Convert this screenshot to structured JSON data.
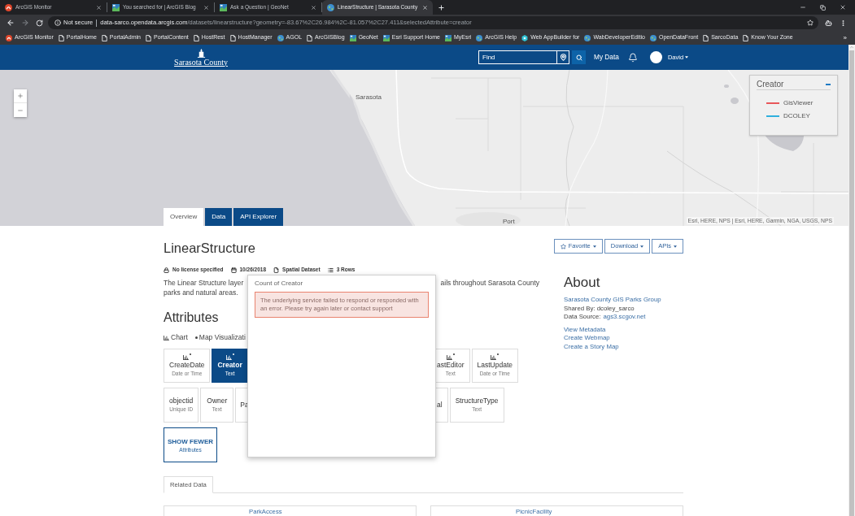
{
  "browser": {
    "tabs": [
      {
        "title": "ArcGIS Monitor",
        "kind": "monitor",
        "selected": false
      },
      {
        "title": "You searched for | ArcGIS Blog",
        "kind": "geonet",
        "selected": false
      },
      {
        "title": "Ask a Question | GeoNet",
        "kind": "geonet",
        "selected": false
      },
      {
        "title": "LinearStructure | Sarasota County",
        "kind": "globe",
        "selected": true
      }
    ],
    "forward_disabled": true,
    "address": {
      "security": "Not secure",
      "domain": "data-sarco.opendata.arcgis.com",
      "path": "/datasets/linearstructure?geometry=-83.67%2C26.984%2C-81.057%2C27.411&selectedAttribute=creator"
    },
    "bookmarks": [
      {
        "label": "ArcGIS Monitor",
        "kind": "monitor"
      },
      {
        "label": "PortalHome",
        "kind": "page"
      },
      {
        "label": "PortalAdmin",
        "kind": "page"
      },
      {
        "label": "PortalContent",
        "kind": "page"
      },
      {
        "label": "HostRest",
        "kind": "page"
      },
      {
        "label": "HostManager",
        "kind": "page"
      },
      {
        "label": "AGOL",
        "kind": "globe"
      },
      {
        "label": "ArcGISBlog",
        "kind": "page"
      },
      {
        "label": "GeoNet",
        "kind": "geonet"
      },
      {
        "label": "Esri Support Home",
        "kind": "geonet"
      },
      {
        "label": "MyEsri",
        "kind": "geonet"
      },
      {
        "label": "ArcGIS Help",
        "kind": "globe"
      },
      {
        "label": "Web AppBuilder for",
        "kind": "appbuilder"
      },
      {
        "label": "WabDeveloperEditio",
        "kind": "globe"
      },
      {
        "label": "OpenDataFront",
        "kind": "globe"
      },
      {
        "label": "SarcoData",
        "kind": "page"
      },
      {
        "label": "Know Your Zone",
        "kind": "page"
      }
    ],
    "bookmarks_more": "»"
  },
  "header": {
    "logo": "Sarasota County",
    "search": {
      "placeholder": "Find"
    },
    "nav_link": "My Data",
    "user": "David"
  },
  "map": {
    "labels": [
      "Sarasota",
      "Port"
    ],
    "legend": {
      "title": "Creator",
      "items": [
        {
          "label": "GisViewer",
          "color": "#e8575a"
        },
        {
          "label": "DCOLEY",
          "color": "#2fb0de"
        }
      ]
    },
    "attribution": "Esri, HERE, NPS | Esri, HERE, Garmin, NGA, USGS, NPS"
  },
  "tabs": [
    {
      "label": "Overview",
      "selected": true
    },
    {
      "label": "Data",
      "selected": false
    },
    {
      "label": "API Explorer",
      "selected": false
    }
  ],
  "dataset": {
    "title": "LinearStructure",
    "actions": [
      {
        "label": "Favorite",
        "kind": "favorite"
      },
      {
        "label": "Download",
        "kind": "menu"
      },
      {
        "label": "APIs",
        "kind": "menu"
      }
    ],
    "meta": [
      {
        "label": "No license specified",
        "kind": "license"
      },
      {
        "label": "10/26/2018",
        "kind": "date"
      },
      {
        "label": "Spatial Dataset",
        "kind": "file"
      },
      {
        "label": "3 Rows",
        "kind": "rows"
      }
    ],
    "description": {
      "line_1_start": "The Linear Structure layer",
      "line_1_end": "ails throughout Sarasota County",
      "line_2": "parks and natural areas."
    }
  },
  "attributes": {
    "heading": "Attributes",
    "views": [
      {
        "label": "Chart",
        "kind": "chart"
      },
      {
        "label": "Map Visualizati",
        "kind": "map"
      }
    ],
    "rows": [
      {
        "before": [
          {
            "name": "CreateDate",
            "type": "Date or Time",
            "kind": "chart",
            "selected": false,
            "partial": false
          },
          {
            "name": "Creator",
            "type": "Text",
            "kind": "chart",
            "selected": true,
            "partial": false
          }
        ],
        "after": [
          {
            "name": "astEditor",
            "type": "Text",
            "kind": "chart",
            "selected": false,
            "partial": true
          },
          {
            "name": "LastUpdate",
            "type": "Date or Time",
            "kind": "chart",
            "selected": false,
            "partial": false
          }
        ]
      },
      {
        "before": [
          {
            "name": "objectid",
            "type": "Unique ID",
            "kind": "plain",
            "selected": false,
            "partial": false
          },
          {
            "name": "Owner",
            "type": "Text",
            "kind": "plain",
            "selected": false,
            "partial": false
          },
          {
            "name": "Pa",
            "kind": "plain",
            "selected": false,
            "partial": true
          }
        ],
        "after": [
          {
            "name": "al",
            "kind": "plain",
            "selected": false,
            "partial": true
          },
          {
            "name": "StructureType",
            "type": "Text",
            "kind": "plain",
            "selected": false,
            "partial": false
          }
        ]
      }
    ],
    "toggle": {
      "label": "SHOW FEWER",
      "sublabel": "Attributes"
    }
  },
  "popover": {
    "title": "Count of Creator",
    "error": "The underlying service failed to respond or responded with an error. Please try again later or contact support"
  },
  "about": {
    "heading": "About",
    "owner": "Sarasota County GIS Parks Group",
    "shared_by": "Shared By: dcoley_sarco",
    "data_source_label": "Data Source:",
    "data_source": "ags3.scgov.net",
    "links": [
      "View Metadata",
      "Create Webmap",
      "Create a Story Map"
    ]
  },
  "related": {
    "tabs": [
      {
        "label": "Related Data",
        "selected": true
      }
    ],
    "items": [
      {
        "name": "ParkAccess"
      },
      {
        "name": "PicnicFacility"
      }
    ]
  }
}
